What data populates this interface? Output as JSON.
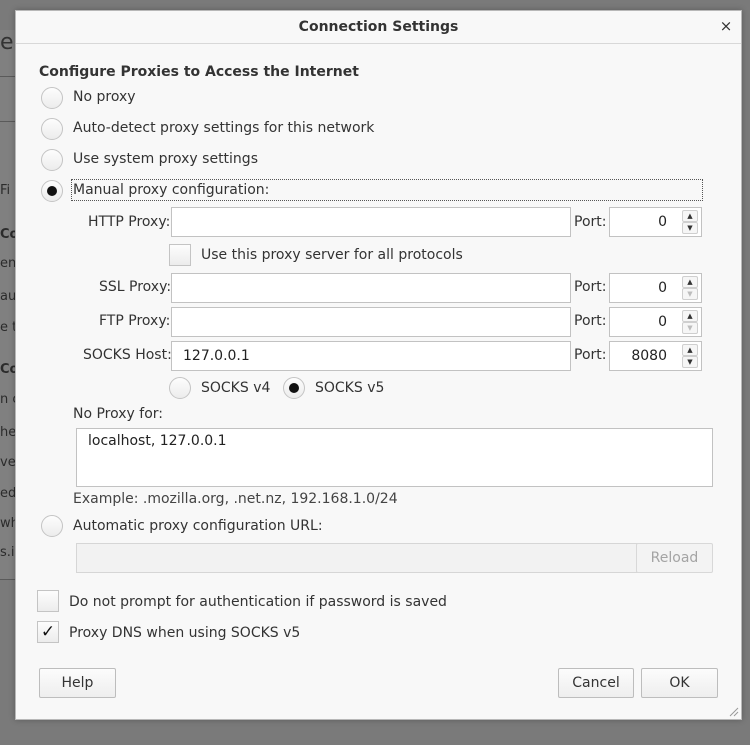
{
  "background": {
    "fragments": [
      "e",
      "Fi",
      "Co",
      "ent",
      "aut",
      "e t",
      "Co",
      "n c",
      "he",
      "ve",
      "edi",
      "wha",
      "s.i"
    ]
  },
  "dialog": {
    "title": "Connection Settings",
    "close_glyph": "×",
    "section_heading": "Configure Proxies to Access the Internet",
    "options": {
      "no_proxy": "No proxy",
      "auto_detect": "Auto-detect proxy settings for this network",
      "system": "Use system proxy settings",
      "manual": "Manual proxy configuration:",
      "auto_url": "Automatic proxy configuration URL:"
    },
    "selected_option": "manual",
    "http": {
      "label": "HTTP Proxy:",
      "value": "",
      "port_label": "Port:",
      "port": "0"
    },
    "use_for_all": {
      "label": "Use this proxy server for all protocols",
      "checked": false
    },
    "ssl": {
      "label": "SSL Proxy:",
      "value": "",
      "port_label": "Port:",
      "port": "0"
    },
    "ftp": {
      "label": "FTP Proxy:",
      "value": "",
      "port_label": "Port:",
      "port": "0"
    },
    "socks": {
      "label": "SOCKS Host:",
      "value": "127.0.0.1",
      "port_label": "Port:",
      "port": "8080"
    },
    "socks_version": {
      "v4": "SOCKS v4",
      "v5": "SOCKS v5",
      "selected": "v5"
    },
    "no_proxy_for": {
      "label": "No Proxy for:",
      "value": "localhost, 127.0.0.1"
    },
    "example": "Example: .mozilla.org, .net.nz, 192.168.1.0/24",
    "auto_url_value": "",
    "reload_label": "Reload",
    "no_auth_prompt": {
      "label": "Do not prompt for authentication if password is saved",
      "checked": false
    },
    "proxy_dns": {
      "label": "Proxy DNS when using SOCKS v5",
      "checked": true,
      "check_glyph": "✓"
    },
    "buttons": {
      "help": "Help",
      "cancel": "Cancel",
      "ok": "OK"
    },
    "spin_up_glyph": "▲",
    "spin_down_glyph": "▼"
  }
}
